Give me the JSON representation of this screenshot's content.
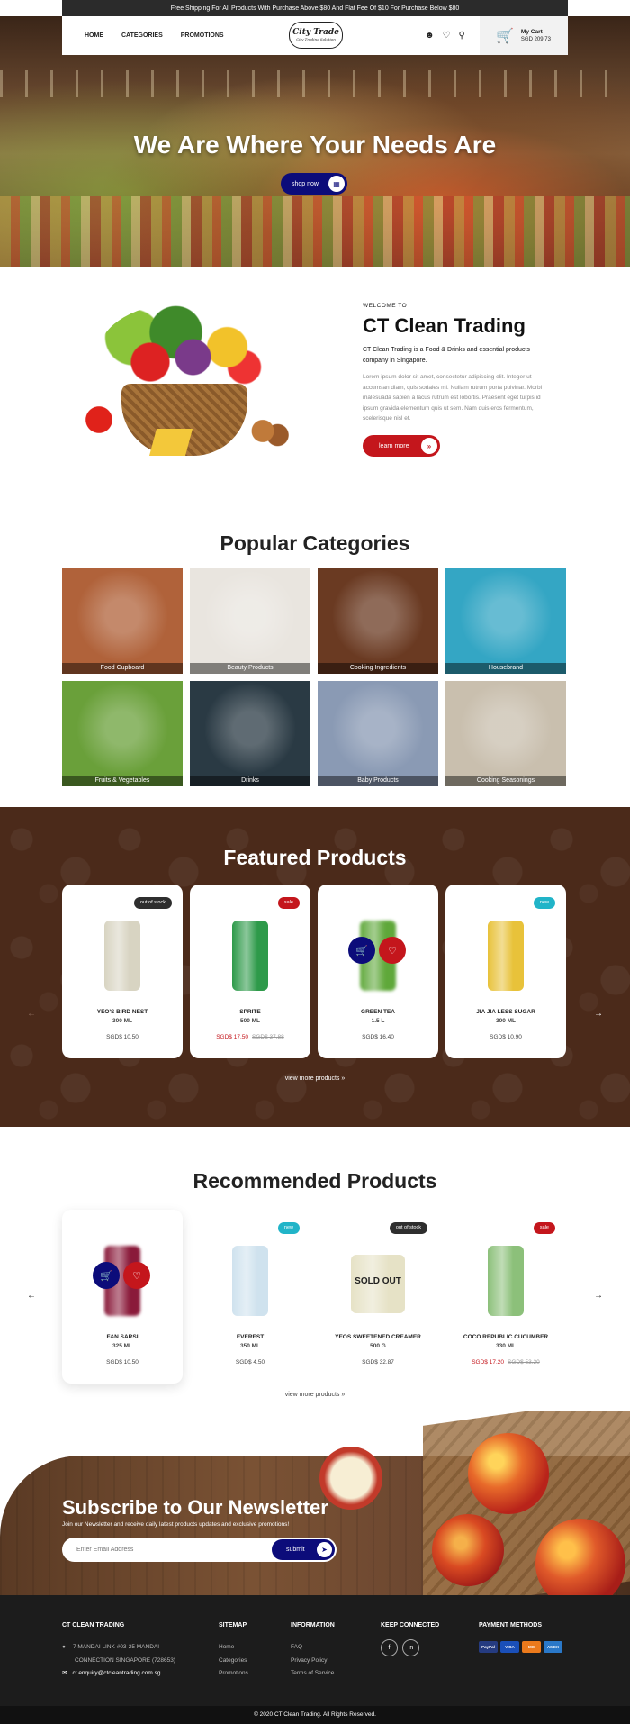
{
  "topbar": {
    "text": "Free Shipping For All Products With Purchase Above $80 And Flat Fee Of $10 For Purchase Below $80"
  },
  "nav": {
    "home": "HOME",
    "categories": "CATEGORIES",
    "promotions": "PROMOTIONS"
  },
  "logo": {
    "line1": "City Trade",
    "line2": "City Trading Solution"
  },
  "cart": {
    "label": "My Cart",
    "total": "SGD 209.73"
  },
  "hero": {
    "title": "We Are Where Your Needs Are",
    "button": "shop now"
  },
  "welcome": {
    "kicker": "WELCOME TO",
    "title": "CT Clean Trading",
    "lead": "CT Clean Trading is a Food & Drinks and essential products company in Singapore.",
    "body": "Lorem ipsum dolor sit amet, consectetur adipiscing elit. Integer ut accumsan diam, quis sodales mi. Nullam rutrum porta pulvinar. Morbi malesuada sapien a lacus rutrum est lobortis. Praesent eget turpis id ipsum gravida elementum quis ut sem. Nam quis eros fermentum, scelerisque nisl et.",
    "button": "learn more"
  },
  "categories": {
    "title": "Popular Categories",
    "items": [
      {
        "label": "Food Cupboard",
        "color": "#b0623a"
      },
      {
        "label": "Beauty Products",
        "color": "#e9e5df"
      },
      {
        "label": "Cooking Ingredients",
        "color": "#6a3a22"
      },
      {
        "label": "Housebrand",
        "color": "#34a6c4"
      },
      {
        "label": "Fruits & Vegetables",
        "color": "#6aa03a"
      },
      {
        "label": "Drinks",
        "color": "#2a3a44"
      },
      {
        "label": "Baby Products",
        "color": "#8a9ab4"
      },
      {
        "label": "Cooking Seasonings",
        "color": "#c9bfae"
      }
    ]
  },
  "featured": {
    "title": "Featured Products",
    "view_more": "view more products",
    "products": [
      {
        "badge": "out of stock",
        "name": "YEO'S BIRD NEST",
        "size": "300 ML",
        "price": "SGD$ 10.50",
        "old": "",
        "img": "#d8d4c2"
      },
      {
        "badge": "sale",
        "name": "SPRITE",
        "size": "500 ML",
        "price": "SGD$ 17.50",
        "old": "SGD$ 37.88",
        "img": "#2e9a4a"
      },
      {
        "badge": "",
        "name": "GREEN TEA",
        "size": "1.5 L",
        "price": "SGD$ 16.40",
        "old": "",
        "img": "#5fa83a"
      },
      {
        "badge": "new",
        "name": "JIA JIA LESS SUGAR",
        "size": "300 ML",
        "price": "SGD$ 10.90",
        "old": "",
        "img": "#e8c23a"
      }
    ]
  },
  "recommended": {
    "title": "Recommended Products",
    "view_more": "view more products",
    "products": [
      {
        "badge": "",
        "name": "F&N SARSI",
        "size": "325 ML",
        "price": "SGD$ 10.50",
        "old": "",
        "img": "#8a1a3a"
      },
      {
        "badge": "new",
        "name": "EVEREST",
        "size": "350 ML",
        "price": "SGD$ 4.50",
        "old": "",
        "img": "#cfe2ee"
      },
      {
        "badge": "out of stock",
        "name": "YEOS SWEETENED CREAMER",
        "size": "500 G",
        "price": "SGD$ 32.87",
        "old": "",
        "img": "#e6e2c6",
        "overlay": "SOLD OUT"
      },
      {
        "badge": "sale",
        "name": "COCO REPUBLIC CUCUMBER",
        "size": "330 ML",
        "price": "SGD$ 17.20",
        "old": "SGD$ 53.20",
        "img": "#8cc07a"
      }
    ]
  },
  "newsletter": {
    "title": "Subscribe to Our Newsletter",
    "subtitle": "Join our Newsletter and receive daily latest products updates and exclusive promotions!",
    "placeholder": "Enter Email Address",
    "button": "submit"
  },
  "footer": {
    "company": {
      "title": "CT CLEAN TRADING",
      "address1": "7 MANDAI LINK #03-25 MANDAI",
      "address2": "CONNECTION SINGAPORE (728653)",
      "email": "ct.enquiry@ctcleantrading.com.sg"
    },
    "sitemap": {
      "title": "SITEMAP",
      "items": [
        "Home",
        "Categories",
        "Promotions"
      ]
    },
    "information": {
      "title": "INFORMATION",
      "items": [
        "FAQ",
        "Privacy Policy",
        "Terms of Service"
      ]
    },
    "connected": {
      "title": "KEEP CONNECTED"
    },
    "payment": {
      "title": "PAYMENT METHODS",
      "methods": [
        "PayPal",
        "VISA",
        "MC",
        "AMEX"
      ]
    },
    "copyright": "© 2020 CT Clean Trading. All Rights Reserved."
  },
  "colors": {
    "brand_blue": "#0c0c7a",
    "brand_red": "#c4161c",
    "brown": "#4b2a1a",
    "teal": "#21b4c8"
  }
}
